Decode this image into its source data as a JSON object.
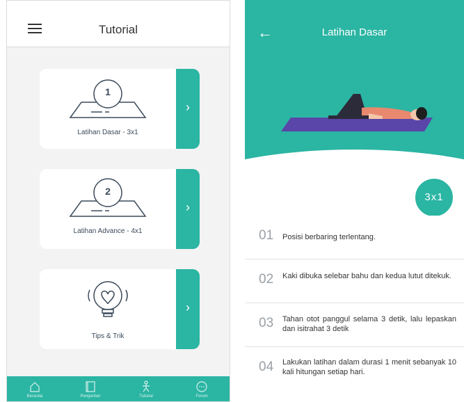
{
  "left_screen": {
    "title": "Tutorial",
    "cards": [
      {
        "number": "1",
        "label": "Latihan Dasar - 3x1"
      },
      {
        "number": "2",
        "label": "Latihan Advance - 4x1"
      },
      {
        "number": "",
        "label": "Tips & Trik"
      }
    ],
    "chevron": "›",
    "nav": [
      {
        "label": "Beranda",
        "icon": "home-icon"
      },
      {
        "label": "Pengertian",
        "icon": "book-icon"
      },
      {
        "label": "Tutorial",
        "icon": "pose-icon"
      },
      {
        "label": "Forum",
        "icon": "chat-icon"
      }
    ]
  },
  "right_screen": {
    "title": "Latihan Dasar",
    "back": "←",
    "badge": "3x1",
    "steps": [
      {
        "num": "01",
        "text": "Posisi berbaring terlentang."
      },
      {
        "num": "02",
        "text": "Kaki dibuka selebar bahu dan kedua lutut ditekuk."
      },
      {
        "num": "03",
        "text": "Tahan otot panggul selama 3 detik, lalu lepaskan dan isitrahat 3 detik"
      },
      {
        "num": "04",
        "text": "Lakukan latihan dalam durasi 1 menit sebanyak 10 kali hitungan setiap hari."
      }
    ]
  },
  "colors": {
    "accent": "#2bb5a3",
    "mat": "#5a45a8",
    "text": "#333333"
  }
}
